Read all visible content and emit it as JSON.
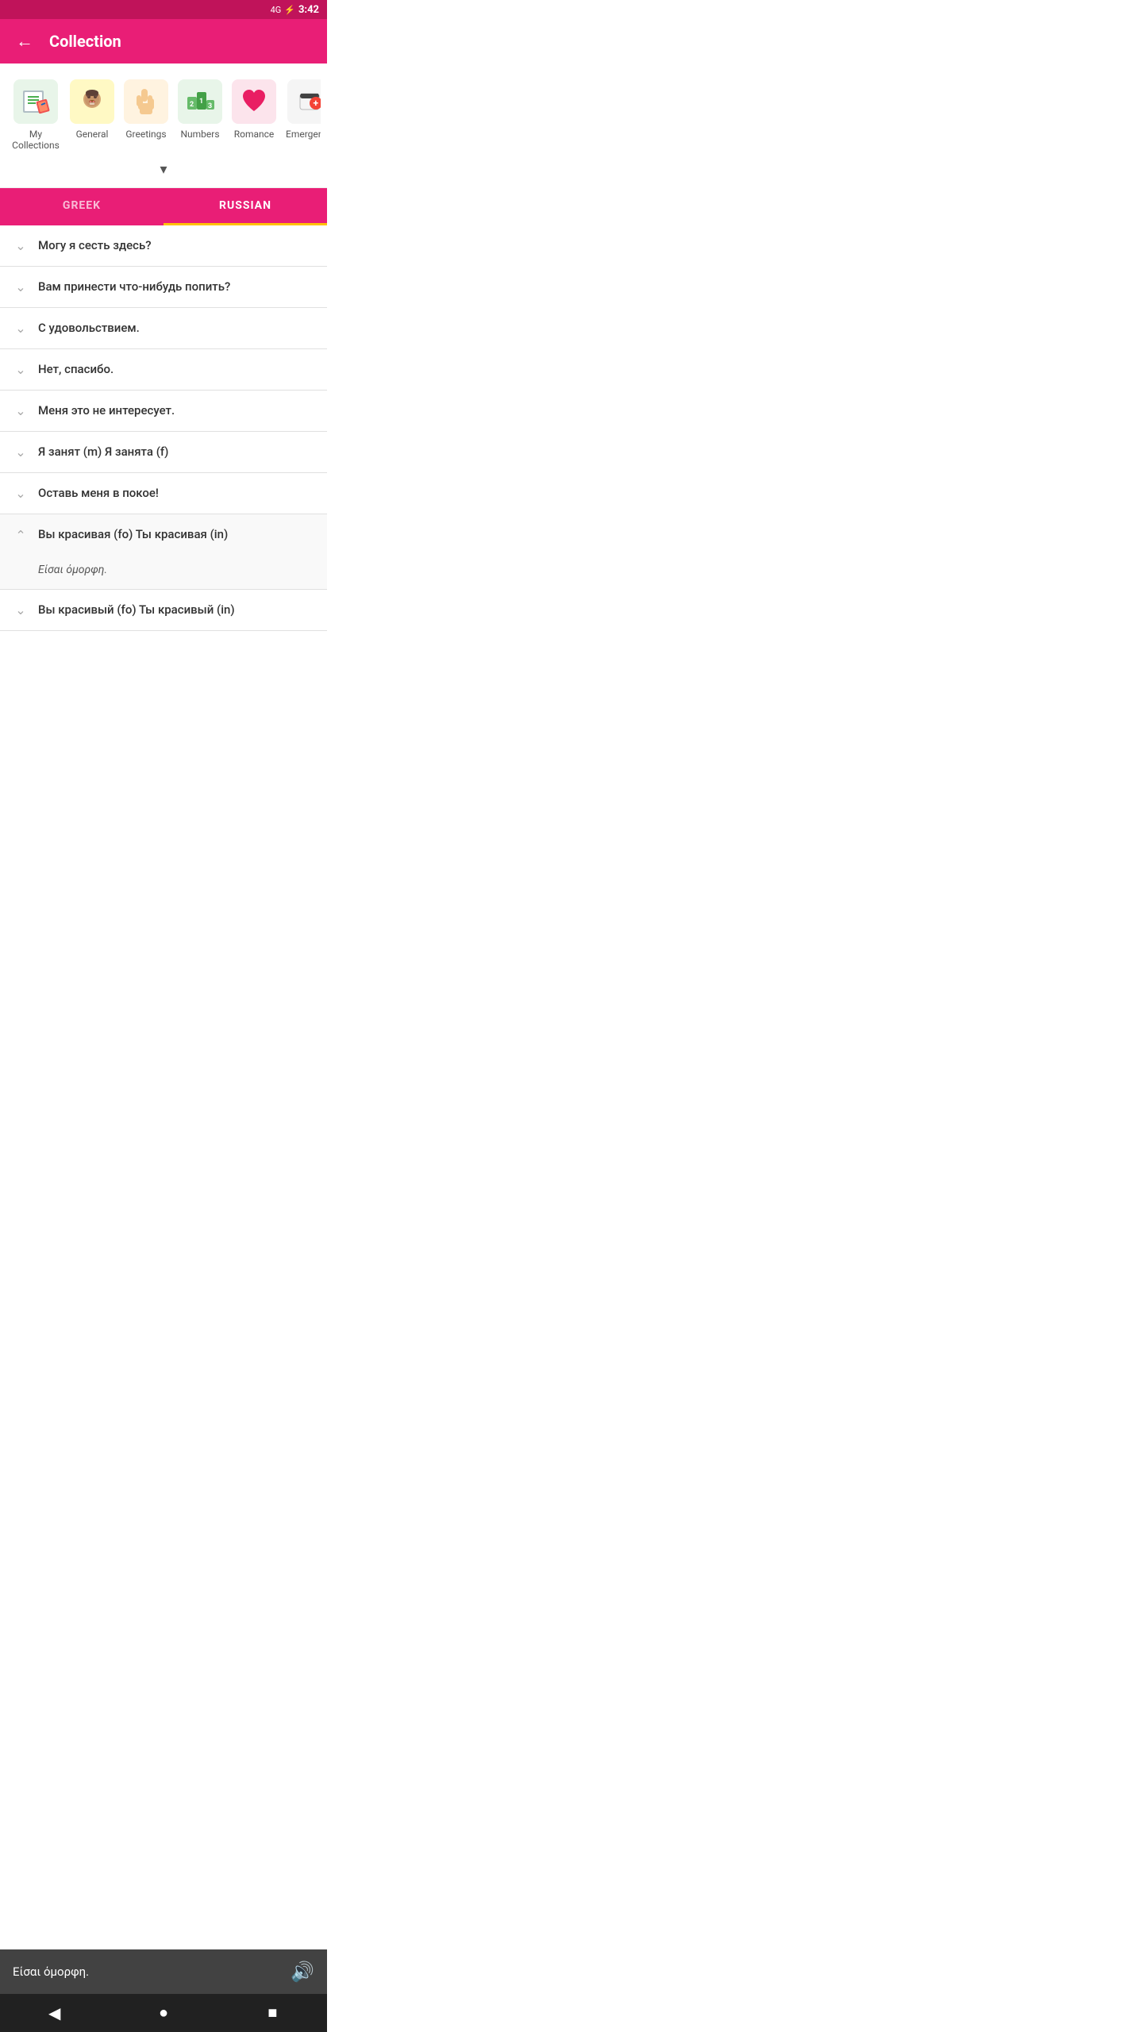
{
  "statusBar": {
    "time": "3:42",
    "signal": "4G",
    "battery": "⚡"
  },
  "appBar": {
    "backLabel": "←",
    "title": "Collection"
  },
  "categories": [
    {
      "id": "my-collections",
      "label": "My Collections",
      "emoji": "📝",
      "bg": "#e8f5e9"
    },
    {
      "id": "general",
      "label": "General",
      "emoji": "😊",
      "bg": "#fff9c4"
    },
    {
      "id": "greetings",
      "label": "Greetings",
      "emoji": "✋",
      "bg": "#fff3e0"
    },
    {
      "id": "numbers",
      "label": "Numbers",
      "emoji": "🔢",
      "bg": "#e8f5e9"
    },
    {
      "id": "romance",
      "label": "Romance",
      "emoji": "❤️",
      "bg": "#fce4ec"
    },
    {
      "id": "emergency",
      "label": "Emergency",
      "emoji": "🚑",
      "bg": "#f5f5f5"
    }
  ],
  "expandLabel": "▾",
  "tabs": [
    {
      "id": "greek",
      "label": "GREEK",
      "active": false
    },
    {
      "id": "russian",
      "label": "RUSSIAN",
      "active": true
    }
  ],
  "phrases": [
    {
      "id": 1,
      "text": "Могу я сесть здесь?",
      "expanded": false,
      "translation": ""
    },
    {
      "id": 2,
      "text": "Вам принести что-нибудь попить?",
      "expanded": false,
      "translation": ""
    },
    {
      "id": 3,
      "text": "С удовольствием.",
      "expanded": false,
      "translation": ""
    },
    {
      "id": 4,
      "text": "Нет, спасибо.",
      "expanded": false,
      "translation": ""
    },
    {
      "id": 5,
      "text": "Меня это не интересует.",
      "expanded": false,
      "translation": ""
    },
    {
      "id": 6,
      "text": "Я занят (m)  Я занята (f)",
      "expanded": false,
      "translation": ""
    },
    {
      "id": 7,
      "text": "Оставь меня в покое!",
      "expanded": false,
      "translation": ""
    },
    {
      "id": 8,
      "text": "Вы красивая (fo)  Ты красивая (in)",
      "expanded": true,
      "translation": "Είσαι όμορφη."
    },
    {
      "id": 9,
      "text": "Вы красивый (fo)  Ты красивый (in)",
      "expanded": false,
      "translation": ""
    }
  ],
  "audioBar": {
    "text": "Είσαι όμορφη.",
    "iconLabel": "🔊"
  },
  "navBar": {
    "back": "◀",
    "home": "●",
    "square": "■"
  }
}
